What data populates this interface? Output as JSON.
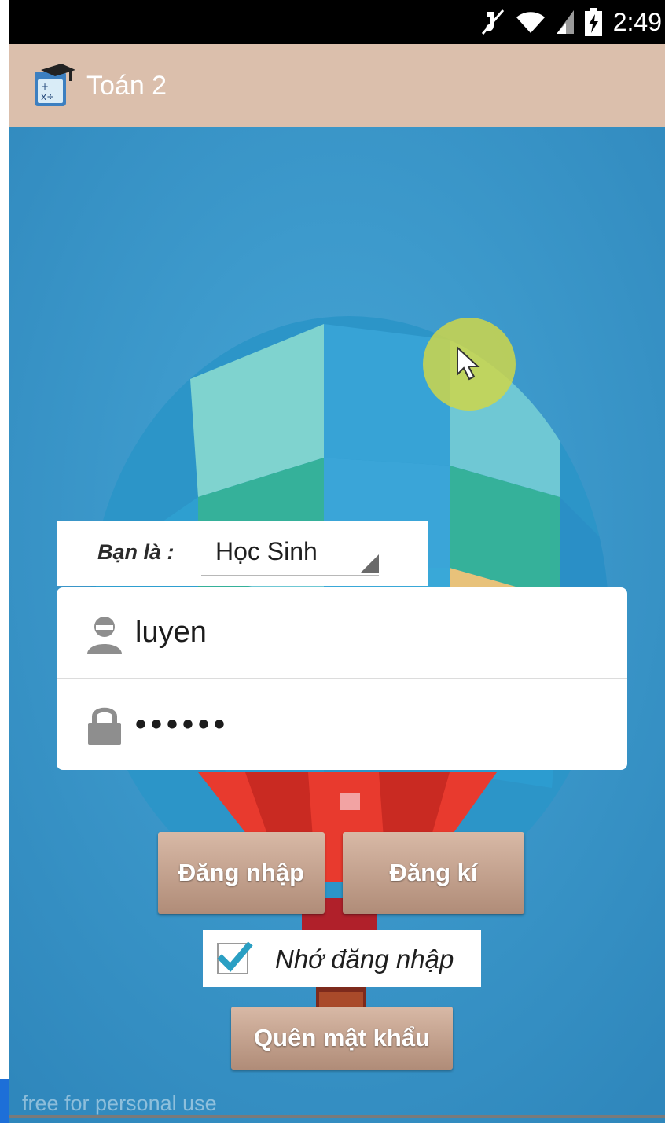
{
  "status_bar": {
    "time": "2:49",
    "icons": [
      "mute-icon",
      "wifi-icon",
      "signal-icon",
      "battery-charging-icon"
    ]
  },
  "action_bar": {
    "title": "Toán 2",
    "app_icon": "calculator-graduation-cap-icon",
    "background_color": "#dbbfac"
  },
  "login": {
    "role_label": "Bạn là :",
    "role_value": "Học Sinh",
    "username": "luyen",
    "password_masked": "••••••",
    "login_button": "Đăng nhập",
    "register_button": "Đăng kí",
    "remember_label": "Nhớ đăng nhập",
    "remember_checked": true,
    "forgot_button": "Quên mật khẩu"
  },
  "watermark": "free for personal use",
  "colors": {
    "background": "#3a98c9",
    "button": "#c4a08c",
    "checkmark": "#2a9fc3",
    "touch_indicator": "#ced64a"
  }
}
